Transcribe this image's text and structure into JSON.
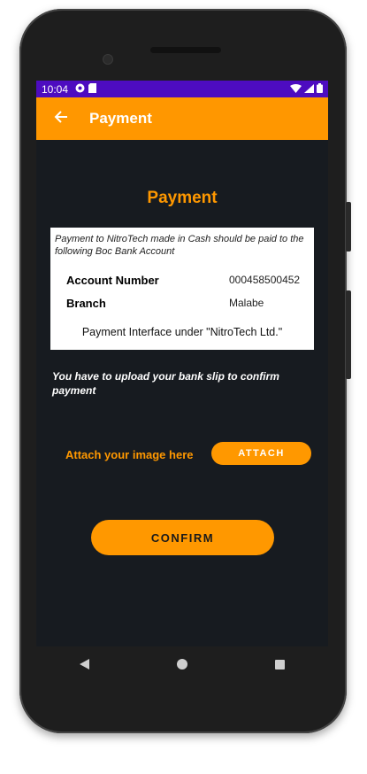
{
  "status_bar": {
    "time": "10:04"
  },
  "app_bar": {
    "title": "Payment"
  },
  "page": {
    "heading": "Payment"
  },
  "payment_card": {
    "note": "Payment to NitroTech made in Cash should be paid to the following Boc Bank Account",
    "account_number_label": "Account Number",
    "account_number_value": "000458500452",
    "branch_label": "Branch",
    "branch_value": "Malabe",
    "footer": "Payment Interface under \"NitroTech Ltd.\""
  },
  "upload": {
    "note": "You have to upload your bank slip to confirm payment",
    "attach_label": "Attach your image here",
    "attach_button": "ATTACH"
  },
  "actions": {
    "confirm_button": "CONFIRM"
  },
  "colors": {
    "accent": "#ff9800",
    "status_bar": "#4d0cc0",
    "background": "#171b20"
  }
}
